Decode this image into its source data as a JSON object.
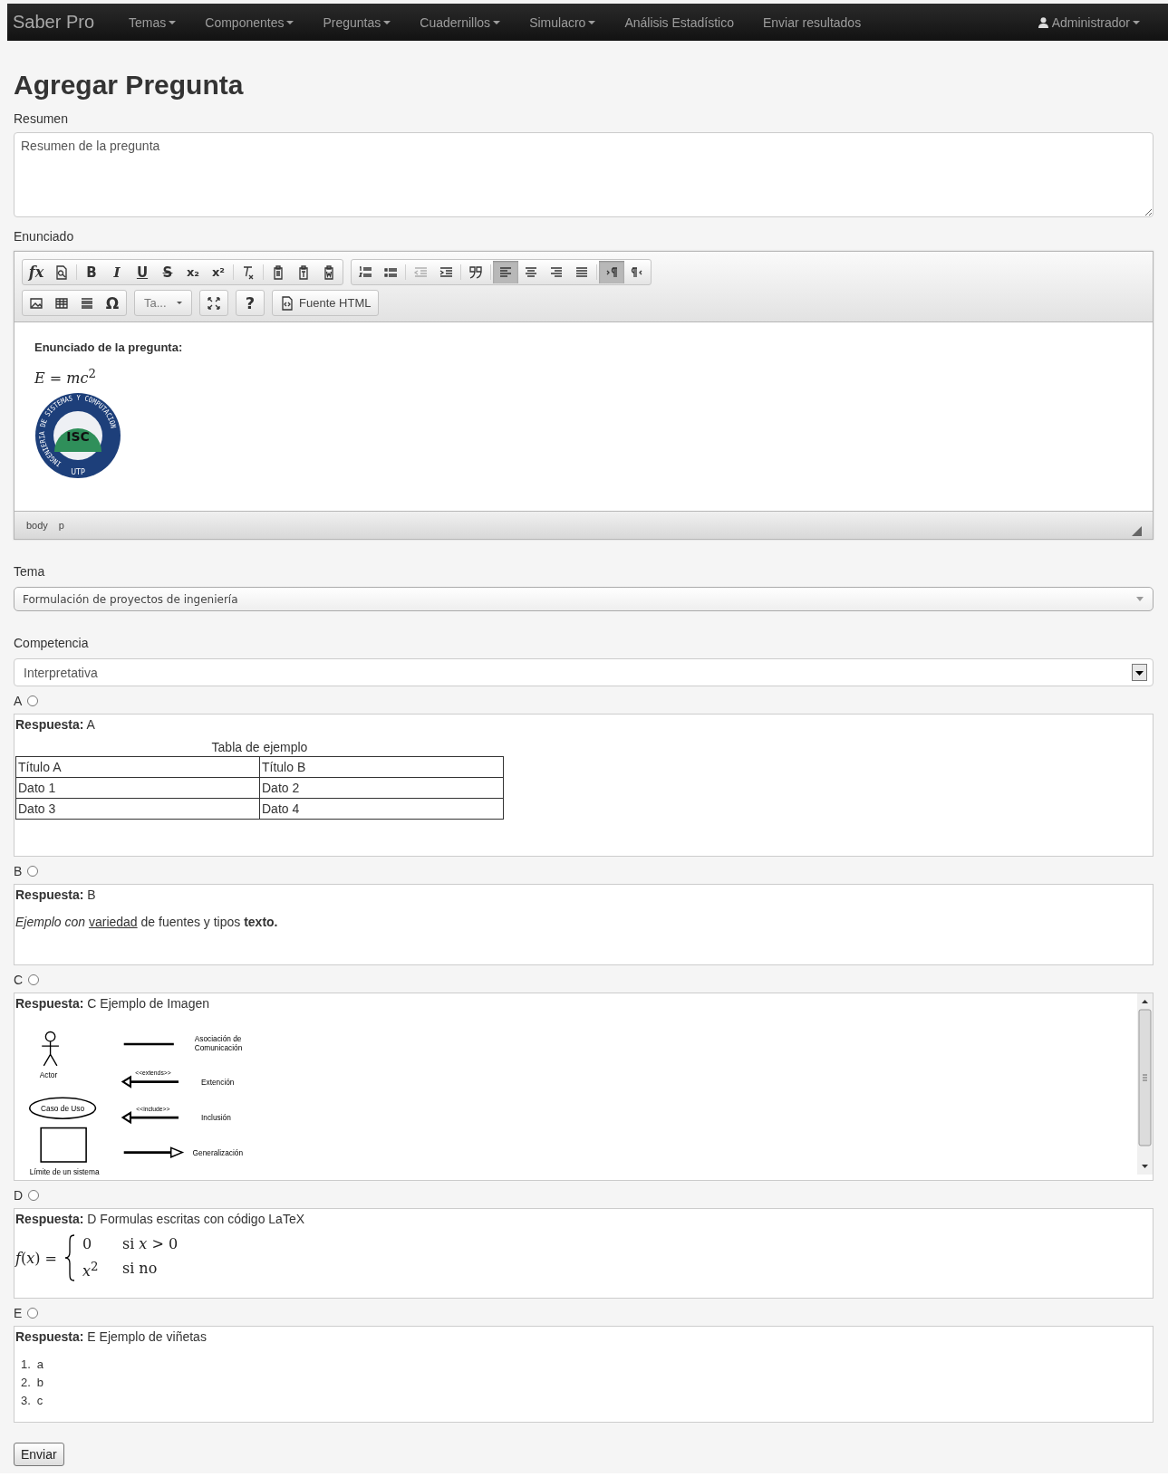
{
  "navbar": {
    "brand": "Saber Pro",
    "items": [
      {
        "label": "Temas",
        "dropdown": true
      },
      {
        "label": "Componentes",
        "dropdown": true
      },
      {
        "label": "Preguntas",
        "dropdown": true
      },
      {
        "label": "Cuadernillos",
        "dropdown": true
      },
      {
        "label": "Simulacro",
        "dropdown": true
      },
      {
        "label": "Análisis Estadístico",
        "dropdown": false
      },
      {
        "label": "Enviar resultados",
        "dropdown": false
      }
    ],
    "user": {
      "label": "Administrador",
      "dropdown": true
    }
  },
  "title": "Agregar Pregunta",
  "summary": {
    "label": "Resumen",
    "placeholder": "Resumen de la pregunta"
  },
  "statement": {
    "label": "Enunciado",
    "toolbar": [
      [
        {
          "kind": "buttons",
          "segments": [
            [
              {
                "kind": "formula",
                "glyph": "fx",
                "selected": false,
                "disabled": false
              },
              {
                "kind": "preview",
                "selected": false,
                "disabled": false
              }
            ],
            [
              {
                "kind": "bold",
                "glyph": "B",
                "selected": false,
                "disabled": false
              },
              {
                "kind": "italic",
                "glyph": "I",
                "selected": false,
                "disabled": false
              },
              {
                "kind": "underline",
                "glyph": "U",
                "selected": false,
                "disabled": false
              },
              {
                "kind": "strike",
                "glyph": "S",
                "selected": false,
                "disabled": false
              },
              {
                "kind": "subscript",
                "glyph": "x₂",
                "selected": false,
                "disabled": false
              },
              {
                "kind": "superscript",
                "glyph": "x²",
                "selected": false,
                "disabled": false
              }
            ],
            [
              {
                "kind": "removeformat",
                "selected": false,
                "disabled": false
              }
            ],
            [
              {
                "kind": "paste",
                "selected": false,
                "disabled": false
              },
              {
                "kind": "pastetext",
                "selected": false,
                "disabled": false
              },
              {
                "kind": "pasteword",
                "selected": false,
                "disabled": false
              }
            ]
          ]
        },
        {
          "kind": "buttons",
          "segments": [
            [
              {
                "kind": "numbered",
                "selected": false,
                "disabled": false
              },
              {
                "kind": "bulleted",
                "selected": false,
                "disabled": false
              }
            ],
            [
              {
                "kind": "outdent",
                "selected": false,
                "disabled": true
              },
              {
                "kind": "indent",
                "selected": false,
                "disabled": false
              }
            ],
            [
              {
                "kind": "quote",
                "selected": false,
                "disabled": false
              }
            ],
            [
              {
                "kind": "alignleft",
                "selected": true,
                "disabled": false
              },
              {
                "kind": "aligncenter",
                "selected": false,
                "disabled": false
              },
              {
                "kind": "alignright",
                "selected": false,
                "disabled": false
              },
              {
                "kind": "justify",
                "selected": false,
                "disabled": false
              }
            ],
            [
              {
                "kind": "ltr",
                "selected": true,
                "disabled": false
              },
              {
                "kind": "rtl",
                "selected": false,
                "disabled": false
              }
            ]
          ]
        }
      ],
      [
        {
          "kind": "buttons",
          "segments": [
            [
              {
                "kind": "image",
                "selected": false,
                "disabled": false
              },
              {
                "kind": "table",
                "selected": false,
                "disabled": false
              },
              {
                "kind": "rule",
                "selected": false,
                "disabled": false
              },
              {
                "kind": "specialchar",
                "glyph": "Ω",
                "selected": false,
                "disabled": false
              }
            ]
          ]
        },
        {
          "kind": "combo",
          "value": "Ta..."
        },
        {
          "kind": "buttons",
          "segments": [
            [
              {
                "kind": "maximize",
                "selected": false,
                "disabled": false
              }
            ]
          ]
        },
        {
          "kind": "buttons",
          "segments": [
            [
              {
                "kind": "help",
                "glyph": "?",
                "selected": false,
                "disabled": false
              }
            ]
          ]
        },
        {
          "kind": "buttons",
          "segments": [
            [
              {
                "kind": "source",
                "label": "Fuente HTML",
                "selected": false,
                "disabled": false
              }
            ]
          ]
        }
      ]
    ],
    "content": {
      "heading": "Enunciado de la pregunta:",
      "formula": "*E* = *mc*$^{2}$",
      "logo": {
        "text": "ISC",
        "ring": "INGENIERIA DE SISTEMAS Y COMPUTACION",
        "bottom": "UTP"
      }
    },
    "path": [
      "body",
      "p"
    ]
  },
  "topic": {
    "label": "Tema",
    "value": "Formulación de proyectos de ingeniería"
  },
  "competence": {
    "label": "Competencia",
    "value": "Interpretativa"
  },
  "answers": [
    {
      "letter": "A",
      "selected": false,
      "heading": "**Respuesta:** A",
      "kind": "table",
      "caption": "Tabla de ejemplo",
      "rows": [
        [
          "Título A",
          "Título B"
        ],
        [
          "Dato 1",
          "Dato 2"
        ],
        [
          "Dato 3",
          "Dato 4"
        ]
      ]
    },
    {
      "letter": "B",
      "selected": false,
      "heading": "**Respuesta:** B",
      "kind": "styled",
      "segments": [
        {
          "text": "Ejemplo con",
          "kind": "italic"
        },
        {
          "text": "variedad",
          "kind": "underline"
        },
        {
          "text": "de fuentes y tipos",
          "kind": "plain"
        },
        {
          "text": "texto.",
          "kind": "bold"
        }
      ]
    },
    {
      "letter": "C",
      "selected": false,
      "heading": "**Respuesta:** C Ejemplo de Imagen",
      "kind": "diagram",
      "symbols": [
        {
          "kind": "actor",
          "label": "Actor"
        },
        {
          "kind": "usecase",
          "label": "Caso de Uso"
        },
        {
          "kind": "boundary",
          "label": "Límite de un sistema"
        }
      ],
      "relations": [
        {
          "kind": "association",
          "label": [
            "Asociación de",
            "Comunicación"
          ]
        },
        {
          "kind": "extends",
          "stereotype": "<<extends>>",
          "label": [
            "Extención"
          ]
        },
        {
          "kind": "include",
          "stereotype": "<<include>>",
          "label": [
            "Inclusión"
          ]
        },
        {
          "kind": "generalization",
          "label": [
            "Generalización"
          ]
        }
      ]
    },
    {
      "letter": "D",
      "selected": false,
      "heading": "**Respuesta:** D Formulas escritas con código LaTeX",
      "kind": "piecewise",
      "lhs": "*f*(*x*) =",
      "cases": [
        {
          "value": "0",
          "condition": "si *x* > 0"
        },
        {
          "value": "*x*$^{2}$",
          "condition": "si no"
        }
      ]
    },
    {
      "letter": "E",
      "selected": false,
      "heading": "**Respuesta:** E Ejemplo de viñetas",
      "kind": "list",
      "items": [
        {
          "marker": "1.",
          "text": "a"
        },
        {
          "marker": "2.",
          "text": "b"
        },
        {
          "marker": "3.",
          "text": "c"
        }
      ]
    }
  ],
  "submit": "Enviar"
}
